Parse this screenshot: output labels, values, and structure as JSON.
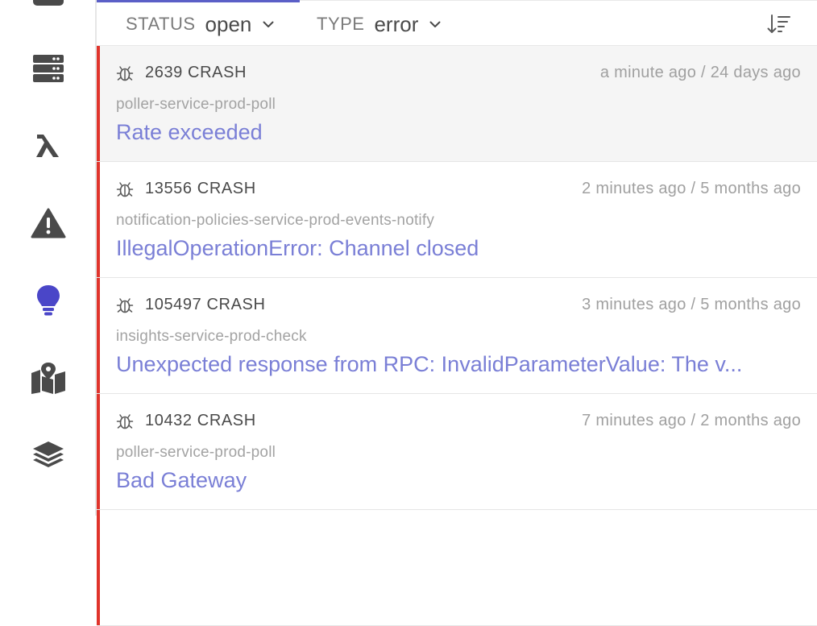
{
  "sidebar": {
    "items": [
      {
        "icon": "server-icon"
      },
      {
        "icon": "lambda-icon"
      },
      {
        "icon": "warning-icon"
      },
      {
        "icon": "lightbulb-icon",
        "active": true
      },
      {
        "icon": "map-icon"
      },
      {
        "icon": "layers-icon"
      }
    ],
    "active_color": "#4a46c8",
    "icon_color": "#4a4a4a"
  },
  "filters": {
    "status_label": "STATUS",
    "status_value": "open",
    "type_label": "TYPE",
    "type_value": "error"
  },
  "sort_icon": "sort-descending-icon",
  "issues": [
    {
      "id_label": "2639 CRASH",
      "time": "a minute ago / 24 days ago",
      "service": "poller-service-prod-poll",
      "message": "Rate exceeded",
      "selected": true
    },
    {
      "id_label": "13556 CRASH",
      "time": "2 minutes ago / 5 months ago",
      "service": "notification-policies-service-prod-events-notify",
      "message": "IllegalOperationError: Channel closed"
    },
    {
      "id_label": "105497 CRASH",
      "time": "3 minutes ago / 5 months ago",
      "service": "insights-service-prod-check",
      "message": "Unexpected response from RPC: InvalidParameterValue: The v..."
    },
    {
      "id_label": "10432 CRASH",
      "time": "7 minutes ago / 2 months ago",
      "service": "poller-service-prod-poll",
      "message": "Bad Gateway"
    }
  ],
  "colors": {
    "severity_bar": "#e0342c",
    "message_link": "#7a7fd6",
    "accent": "#5b5fc7",
    "selected_row_bg": "#f5f5f5"
  }
}
